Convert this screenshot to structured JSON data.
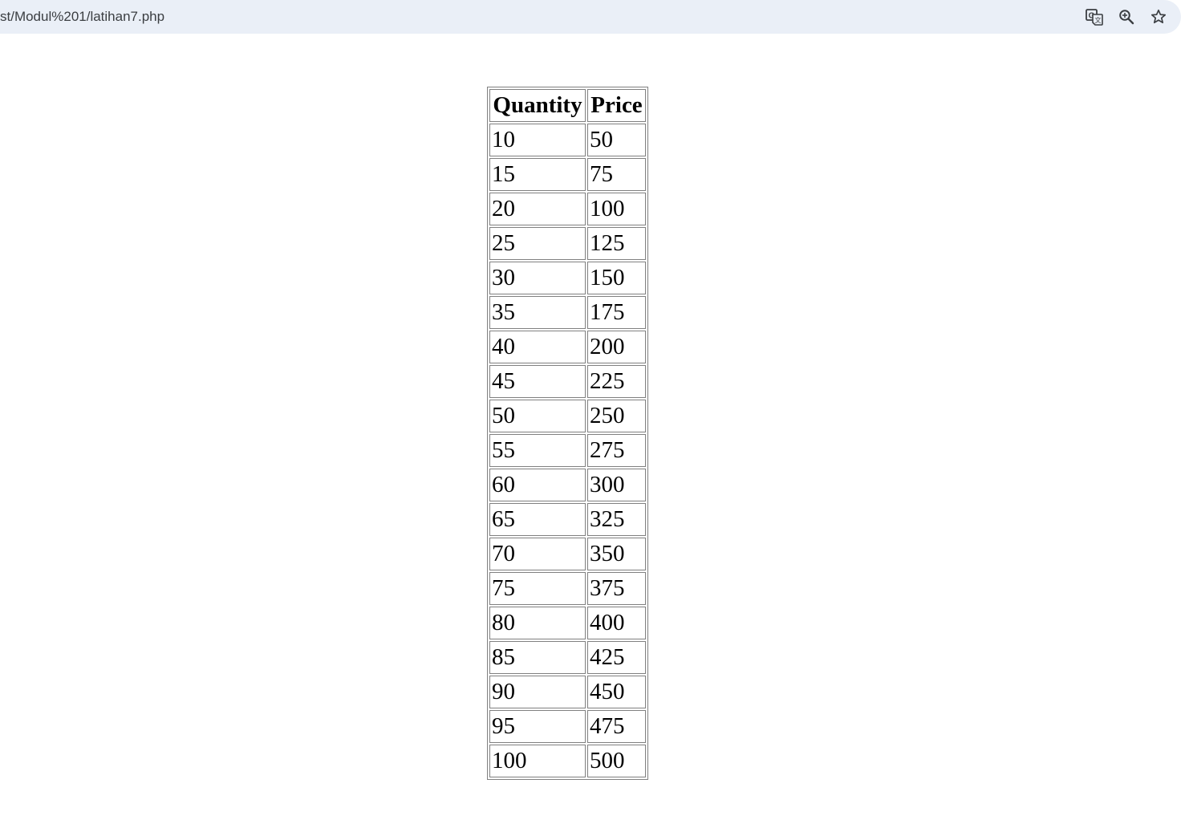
{
  "browser": {
    "url": "st/Modul%201/latihan7.php",
    "icons": [
      "translate-icon",
      "zoom-icon",
      "bookmark-star-icon"
    ]
  },
  "table": {
    "headers": [
      "Quantity",
      "Price"
    ],
    "rows": [
      [
        "10",
        "50"
      ],
      [
        "15",
        "75"
      ],
      [
        "20",
        "100"
      ],
      [
        "25",
        "125"
      ],
      [
        "30",
        "150"
      ],
      [
        "35",
        "175"
      ],
      [
        "40",
        "200"
      ],
      [
        "45",
        "225"
      ],
      [
        "50",
        "250"
      ],
      [
        "55",
        "275"
      ],
      [
        "60",
        "300"
      ],
      [
        "65",
        "325"
      ],
      [
        "70",
        "350"
      ],
      [
        "75",
        "375"
      ],
      [
        "80",
        "400"
      ],
      [
        "85",
        "425"
      ],
      [
        "90",
        "450"
      ],
      [
        "95",
        "475"
      ],
      [
        "100",
        "500"
      ]
    ]
  }
}
